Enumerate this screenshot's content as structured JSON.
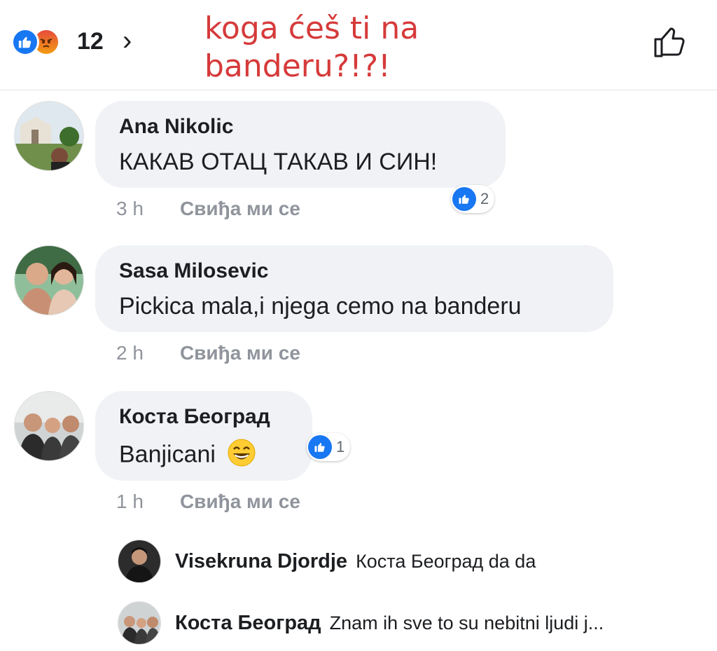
{
  "header": {
    "reaction_count": "12",
    "chevron": "›",
    "caption": "koga ćeš ti na banderu?!?!",
    "reaction_icons": [
      "like-reaction-icon",
      "angry-reaction-icon"
    ]
  },
  "comments": [
    {
      "author": "Ana Nikolic",
      "text": "КАКАВ ОТАЦ ТАКАВ И СИН!",
      "time": "3 h",
      "like_label": "Свиђа ми се",
      "reactions": "2"
    },
    {
      "author": "Sasa Milosevic",
      "text": "Pickica mala,i njega cemo na banderu",
      "time": "2 h",
      "like_label": "Свиђа ми се"
    },
    {
      "author": "Коста Београд",
      "text": "Banjicani",
      "emoji": "😄",
      "time": "1 h",
      "like_label": "Свиђа ми се",
      "reactions": "1"
    }
  ],
  "replies": [
    {
      "author": "Visekruna Djordje",
      "text": "Коста Београд da da"
    },
    {
      "author": "Коста Београд",
      "text": "Znam ih sve to su nebitni ljudi j..."
    }
  ],
  "colors": {
    "accent": "#1877f2",
    "caption": "#d63a3a",
    "bubble": "#f0f2f5",
    "meta": "#90949c"
  }
}
